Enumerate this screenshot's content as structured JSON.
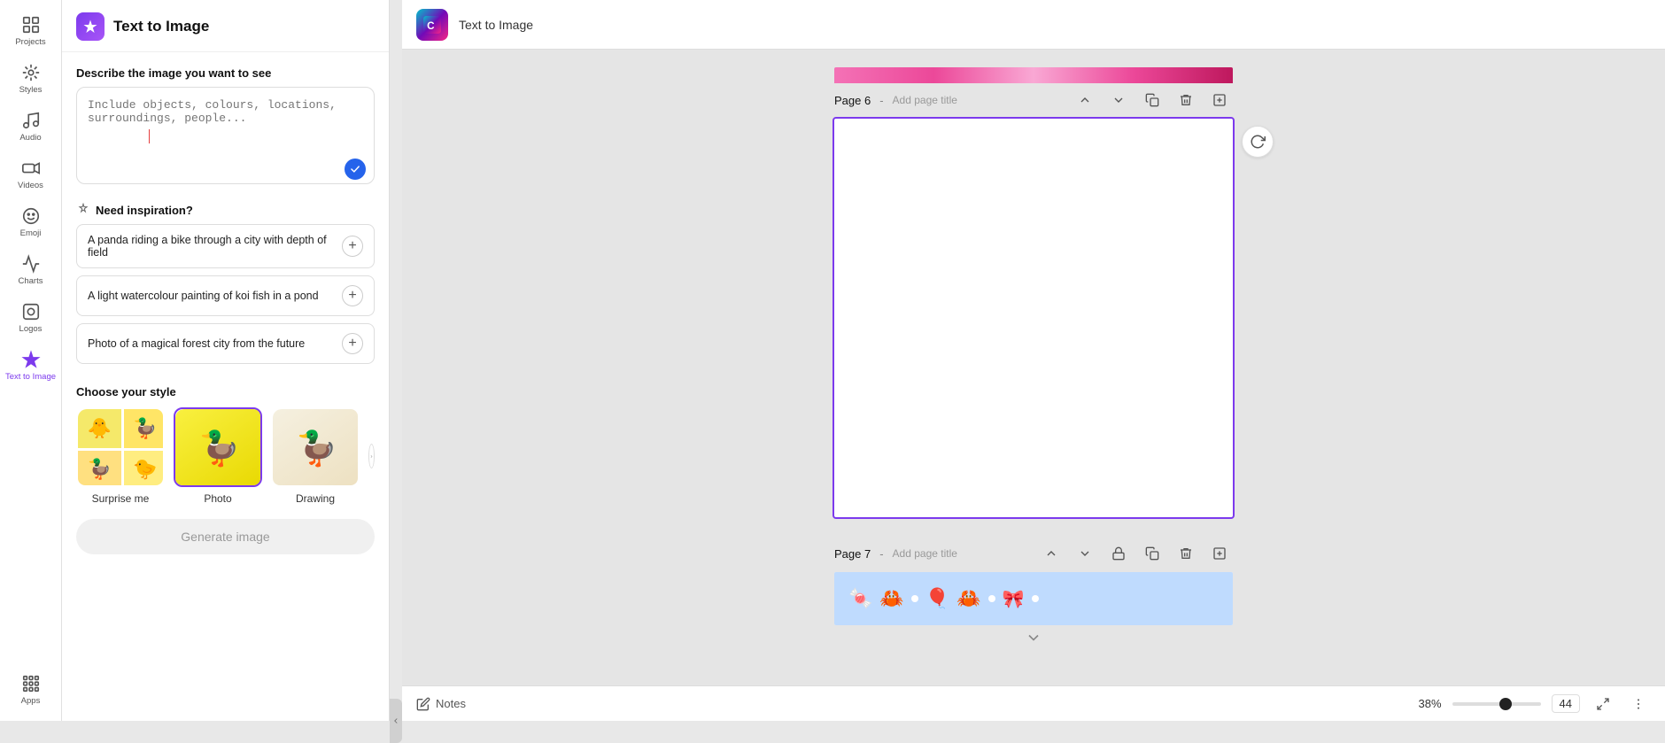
{
  "app": {
    "title": "Text to Image"
  },
  "sidebar": {
    "items": [
      {
        "id": "projects",
        "label": "Projects",
        "icon": "grid"
      },
      {
        "id": "styles",
        "label": "Styles",
        "icon": "paint"
      },
      {
        "id": "audio",
        "label": "Audio",
        "icon": "music"
      },
      {
        "id": "videos",
        "label": "Videos",
        "icon": "video"
      },
      {
        "id": "emoji",
        "label": "Emoji",
        "icon": "emoji"
      },
      {
        "id": "charts",
        "label": "Charts",
        "icon": "chart"
      },
      {
        "id": "logos",
        "label": "Logos",
        "icon": "logo"
      },
      {
        "id": "text-to-image",
        "label": "Text to Image",
        "icon": "sparkle",
        "active": true
      }
    ]
  },
  "panel": {
    "header_icon": "sparkle",
    "title": "Text to Image",
    "describe_label": "Describe the image you want to see",
    "prompt_placeholder": "Include objects, colours, locations, surroundings, people...",
    "inspiration_label": "Need inspiration?",
    "suggestions": [
      {
        "text": "A panda riding a bike through a city with depth of field"
      },
      {
        "text": "A light watercolour painting of koi fish in a pond"
      },
      {
        "text": "Photo of a magical forest city from the future"
      }
    ],
    "choose_style_label": "Choose your style",
    "styles": [
      {
        "id": "surprise",
        "label": "Surprise me"
      },
      {
        "id": "photo",
        "label": "Photo"
      },
      {
        "id": "drawing",
        "label": "Drawing"
      }
    ],
    "generate_label": "Generate image"
  },
  "canvas": {
    "page6": {
      "number": "Page 6",
      "add_title_placeholder": "Add page title"
    },
    "page7": {
      "number": "Page 7",
      "add_title_placeholder": "Add page title"
    }
  },
  "bottom_bar": {
    "notes_label": "Notes",
    "zoom_percent": "38%",
    "page_number": "44"
  }
}
